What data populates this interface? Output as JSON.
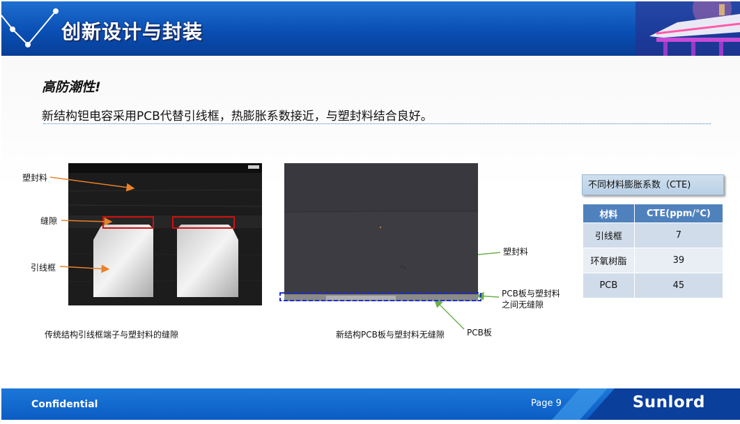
{
  "header": {
    "title": "创新设计与封装"
  },
  "content": {
    "subtitle": "高防潮性!",
    "description": "新结构钽电容采用PCB代替引线框，热膨胀系数接近，与塑封料结合良好。"
  },
  "left_image": {
    "labels": {
      "molding": "塑封料",
      "gap": "缝隙",
      "leadframe": "引线框"
    },
    "caption": "传统结构引线框端子与塑封料的缝隙"
  },
  "right_image": {
    "labels": {
      "molding": "塑封料",
      "no_gap_line1": "PCB板与塑封料",
      "no_gap_line2": "之间无缝隙",
      "pcb": "PCB板"
    },
    "caption": "新结构PCB板与塑封料无缝隙"
  },
  "cte": {
    "title": "不同材料膨胀系数（CTE)",
    "headers": [
      "材料",
      "CTE(ppm/℃)"
    ],
    "rows": [
      {
        "material": "引线框",
        "value": "7"
      },
      {
        "material": "环氧树脂",
        "value": "39"
      },
      {
        "material": "PCB",
        "value": "45"
      }
    ]
  },
  "footer": {
    "confidential": "Confidential",
    "page": "Page 9",
    "logo": "Sunlord"
  },
  "colors": {
    "header_blue": "#0a4fb4",
    "footer_blue": "#1c78d8",
    "table_header": "#4f81bd",
    "arrow_orange": "#e8822a",
    "arrow_green": "#6ab04c",
    "box_red": "#d01010",
    "box_blue": "#1a2fd0"
  }
}
